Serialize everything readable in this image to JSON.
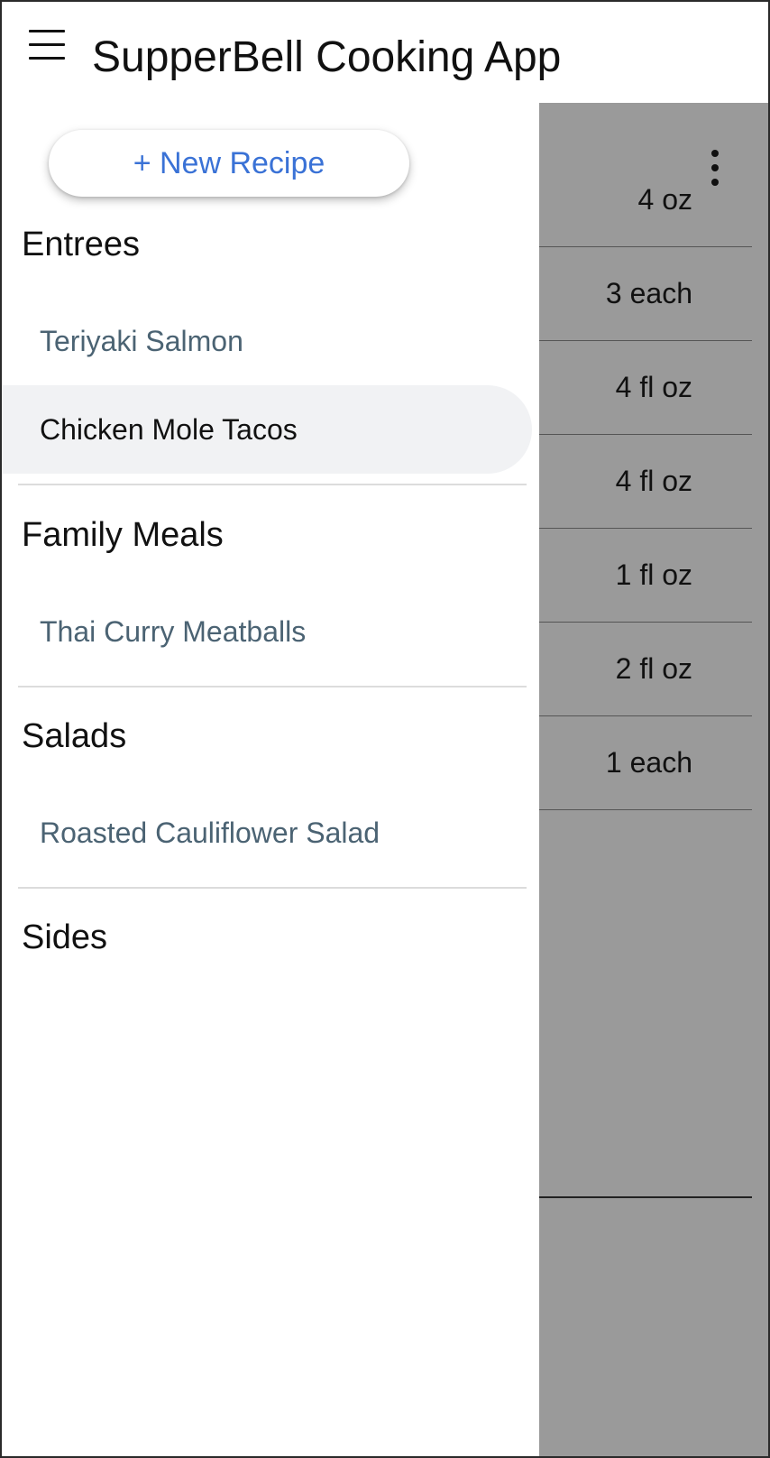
{
  "app": {
    "title": "SupperBell Cooking App"
  },
  "drawer": {
    "new_recipe_label": "+ New Recipe",
    "sections": [
      {
        "title": "Entrees",
        "items": [
          "Teriyaki Salmon",
          "Chicken Mole Tacos"
        ],
        "active_item": "Chicken Mole Tacos"
      },
      {
        "title": "Family Meals",
        "items": [
          "Thai Curry Meatballs"
        ]
      },
      {
        "title": "Salads",
        "items": [
          "Roasted Cauliflower Salad"
        ]
      },
      {
        "title": "Sides",
        "items": []
      }
    ]
  },
  "background": {
    "quantities": [
      "4 oz",
      "3 each",
      "4 fl oz",
      "4 fl oz",
      "1 fl oz",
      "2 fl oz",
      "1 each"
    ]
  },
  "colors": {
    "accent_blue": "#3a72d6",
    "scrim_gray": "#9a9a9a",
    "item_text": "#4b6373",
    "active_item_bg": "#f1f2f4"
  },
  "icons": {
    "menu": "hamburger-menu-icon",
    "overflow": "more-vert-icon"
  }
}
